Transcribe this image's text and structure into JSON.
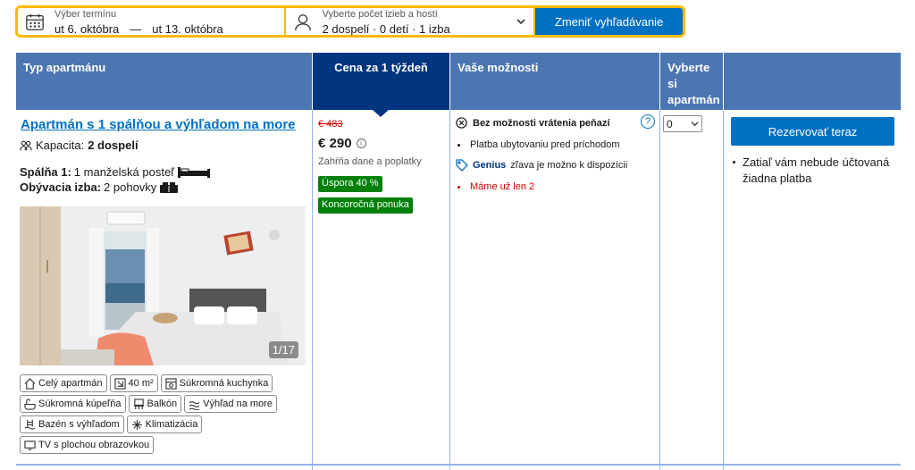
{
  "search": {
    "date_label": "Výber termínu",
    "date_from": "ut 6. októbra",
    "date_sep": "—",
    "date_to": "ut 13. októbra",
    "guests_label": "Vyberte počet izieb a hostí",
    "guests_value": "2 dospelí · 0 detí · 1 izba",
    "button_label": "Zmeniť vyhľadávanie"
  },
  "table": {
    "headers": {
      "type": "Typ apartmánu",
      "price": "Cena za 1 týždeň",
      "options": "Vaše možnosti",
      "select": "Vyberte si apartmán"
    },
    "room": {
      "title": "Apartmán s 1 spálňou a výhľadom na more",
      "capacity_label": "Kapacita:",
      "capacity_value": "2 dospelí",
      "bedroom_label": "Spálňa 1:",
      "bedroom_value": "1 manželská posteľ",
      "living_label": "Obývacia izba:",
      "living_value": "2 pohovky",
      "photo_counter": "1/17",
      "facilities": [
        {
          "icon": "house-icon",
          "label": "Celý apartmán"
        },
        {
          "icon": "area-icon",
          "label": "40 m²"
        },
        {
          "icon": "kitchen-icon",
          "label": "Súkromná kuchynka"
        },
        {
          "icon": "bathroom-icon",
          "label": "Súkromná kúpeľňa"
        },
        {
          "icon": "balcony-icon",
          "label": "Balkón"
        },
        {
          "icon": "sea-view-icon",
          "label": "Výhľad na more"
        },
        {
          "icon": "pool-icon",
          "label": "Bazén s výhľadom"
        },
        {
          "icon": "snowflake-icon",
          "label": "Klimatizácia"
        },
        {
          "icon": "tv-icon",
          "label": "TV s plochou obrazovkou"
        }
      ]
    },
    "price": {
      "old": "€ 483",
      "current": "€ 290",
      "info_icon": "info-icon",
      "tax_note": "Zahŕňa dane a poplatky",
      "badge_savings": "Úspora 40 %",
      "badge_deal": "Koncoročná ponuka"
    },
    "options": {
      "refund": "Bez možnosti vrátenia peňazí",
      "payment": "Platba ubytovaniu pred príchodom",
      "genius_brand": "Genius",
      "genius_text": "zľava je možno k dispozícii",
      "scarcity": "Máme už len 2"
    },
    "select_value": "0",
    "reserve_button": "Rezervovať teraz",
    "reserve_note": "Zatiaľ vám nebude účtovaná žiadna platba"
  },
  "colors": {
    "header_blue": "#4c76b2",
    "header_dark": "#003580",
    "brand_blue": "#0071c2",
    "search_yellow": "#febb02",
    "badge_green": "#008009",
    "scarcity_red": "#cc0000"
  }
}
